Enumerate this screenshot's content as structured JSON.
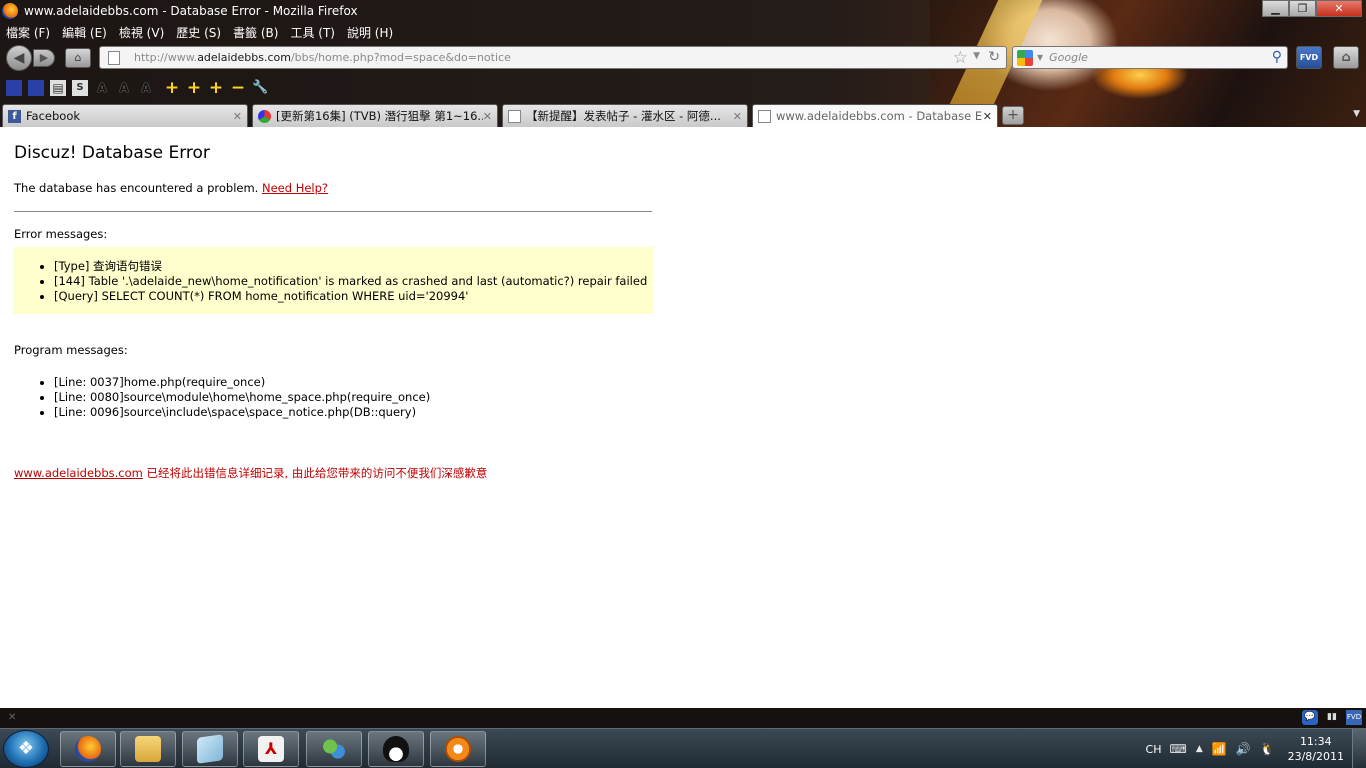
{
  "window": {
    "title": "www.adelaidebbs.com - Database Error - Mozilla Firefox",
    "minimize": "▁",
    "maximize": "❐",
    "close": "✕"
  },
  "menu": [
    {
      "label": "檔案 (F)"
    },
    {
      "label": "編輯 (E)"
    },
    {
      "label": "檢視 (V)"
    },
    {
      "label": "歷史 (S)"
    },
    {
      "label": "書籤 (B)"
    },
    {
      "label": "工具 (T)"
    },
    {
      "label": "說明 (H)"
    }
  ],
  "navigation": {
    "url_prefix": "http://www.",
    "url_host": "adelaidebbs.com",
    "url_path": "/bbs/home.php?mod=space&do=notice",
    "search_placeholder": "Google"
  },
  "bookmarks_toolbar": {
    "icons": [
      "bookmark-icon",
      "bookmark-icon",
      "clipboard-icon",
      "s-icon",
      "font-size-icon",
      "font-size-icon",
      "font-size-icon",
      "plus-icon",
      "plus-icon",
      "plus-icon",
      "minus-icon",
      "wrench-icon"
    ]
  },
  "tabs": [
    {
      "label": "Facebook",
      "icon": "facebook-icon",
      "active": false
    },
    {
      "label": "[更新第16集] (TVB) 潛行狙擊 第1~16...",
      "icon": "site-icon",
      "active": false
    },
    {
      "label": "【新提醒】发表帖子 - 灌水区 - 阿德...",
      "icon": "page-icon",
      "active": false
    },
    {
      "label": "www.adelaidebbs.com - Database Error",
      "icon": "page-icon",
      "active": true
    }
  ],
  "page": {
    "title": "Discuz! Database Error",
    "intro": "The database has encountered a problem.",
    "help_link": "Need Help?",
    "error_section_label": "Error messages:",
    "error_messages": [
      "[Type] 查询语句错误",
      "[144] Table '.\\adelaide_new\\home_notification' is marked as crashed and last (automatic?) repair failed",
      "[Query] SELECT COUNT(*) FROM home_notification WHERE uid='20994'"
    ],
    "program_section_label": "Program messages:",
    "program_messages": [
      "[Line: 0037]home.php(require_once)",
      "[Line: 0080]source\\module\\home\\home_space.php(require_once)",
      "[Line: 0096]source\\include\\space\\space_notice.php(DB::query)"
    ],
    "footer_link": "www.adelaidebbs.com",
    "footer_text": " 已经将此出错信息详细记录, 由此给您带来的访问不便我们深感歉意"
  },
  "taskbar": {
    "apps": [
      {
        "name": "firefox-icon"
      },
      {
        "name": "explorer-icon"
      },
      {
        "name": "notepad-icon"
      },
      {
        "name": "pdf-icon"
      },
      {
        "name": "messenger-icon"
      },
      {
        "name": "qq-icon"
      },
      {
        "name": "media-player-icon"
      }
    ],
    "language": "CH",
    "clock_time": "11:34",
    "clock_date": "23/8/2011"
  }
}
